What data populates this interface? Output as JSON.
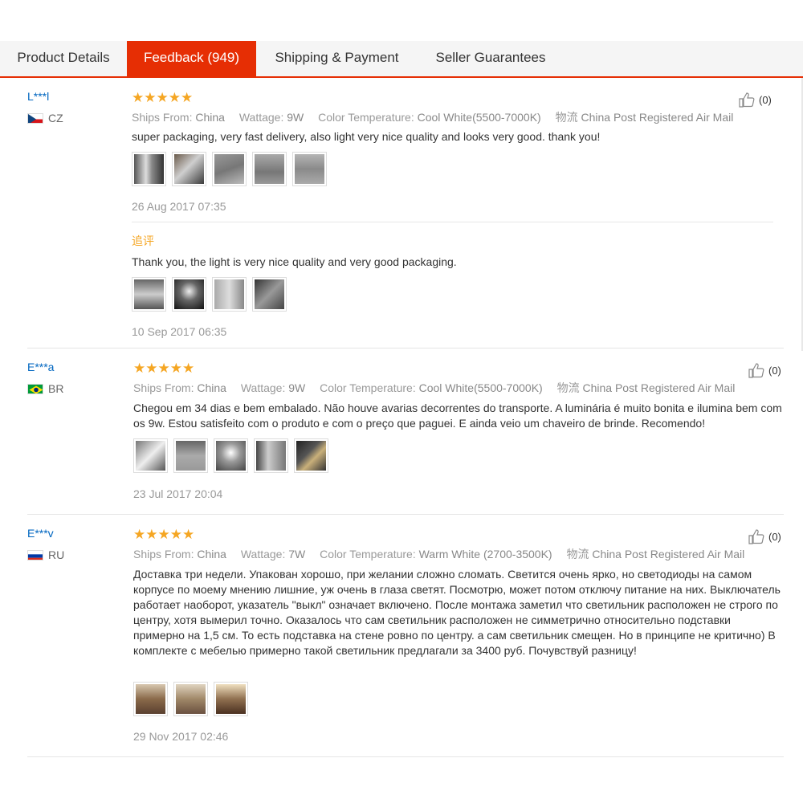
{
  "tabs": [
    "Product Details",
    "Feedback (949)",
    "Shipping & Payment",
    "Seller Guarantees"
  ],
  "labels": {
    "ships_from": "Ships From:",
    "wattage": "Wattage:",
    "color_temp": "Color Temperature:",
    "shipping": "物流"
  },
  "reviews": [
    {
      "user": "L***l",
      "country": "CZ",
      "rating": "★★★★★",
      "likes": "(0)",
      "ships_from": "China",
      "wattage": "9W",
      "color_temp": "Cool White(5500-7000K)",
      "shipping": "China Post Registered Air Mail",
      "text": "super packaging, very fast delivery, also light very nice quality and looks very good. thank you!",
      "date": "26 Aug 2017 07:35",
      "followup_label": "追评",
      "followup_text": "Thank you, the light is very nice quality and very good packaging.",
      "followup_date": "10 Sep 2017 06:35"
    },
    {
      "user": "E***a",
      "country": "BR",
      "rating": "★★★★★",
      "likes": "(0)",
      "ships_from": "China",
      "wattage": "9W",
      "color_temp": "Cool White(5500-7000K)",
      "shipping": "China Post Registered Air Mail",
      "text": "Chegou em 34 dias e bem embalado. Não houve avarias decorrentes do transporte. A luminária é muito bonita e ilumina bem com os 9w. Estou satisfeito com o produto e com o preço que paguei. E ainda veio um chaveiro de brinde. Recomendo!",
      "date": "23 Jul 2017 20:04"
    },
    {
      "user": "E***v",
      "country": "RU",
      "rating": "★★★★★",
      "likes": "(0)",
      "ships_from": "China",
      "wattage": "7W",
      "color_temp": "Warm White (2700-3500K)",
      "shipping": "China Post Registered Air Mail",
      "text": "Доставка три недели. Упакован хорошо, при желании сложно сломать. Светится очень ярко, но светодиоды на самом корпусе по моему мнению лишние, уж очень в глаза светят. Посмотрю, может потом отключу питание на них. Выключатель работает наоборот, указатель \"выкл\" означает включено. После монтажа заметил что светильник расположен не строго по центру, хотя вымерил точно. Оказалось что сам светильник расположен не симметрично относительно подставки примерно на 1,5 см. То есть подставка на стене ровно по центру. а сам светильник смещен. Но в принципе не критично) В комплекте с мебелью примерно такой светильник предлагали за 3400 руб. Почувствуй разницу!",
      "date": "29 Nov 2017 02:46"
    }
  ]
}
